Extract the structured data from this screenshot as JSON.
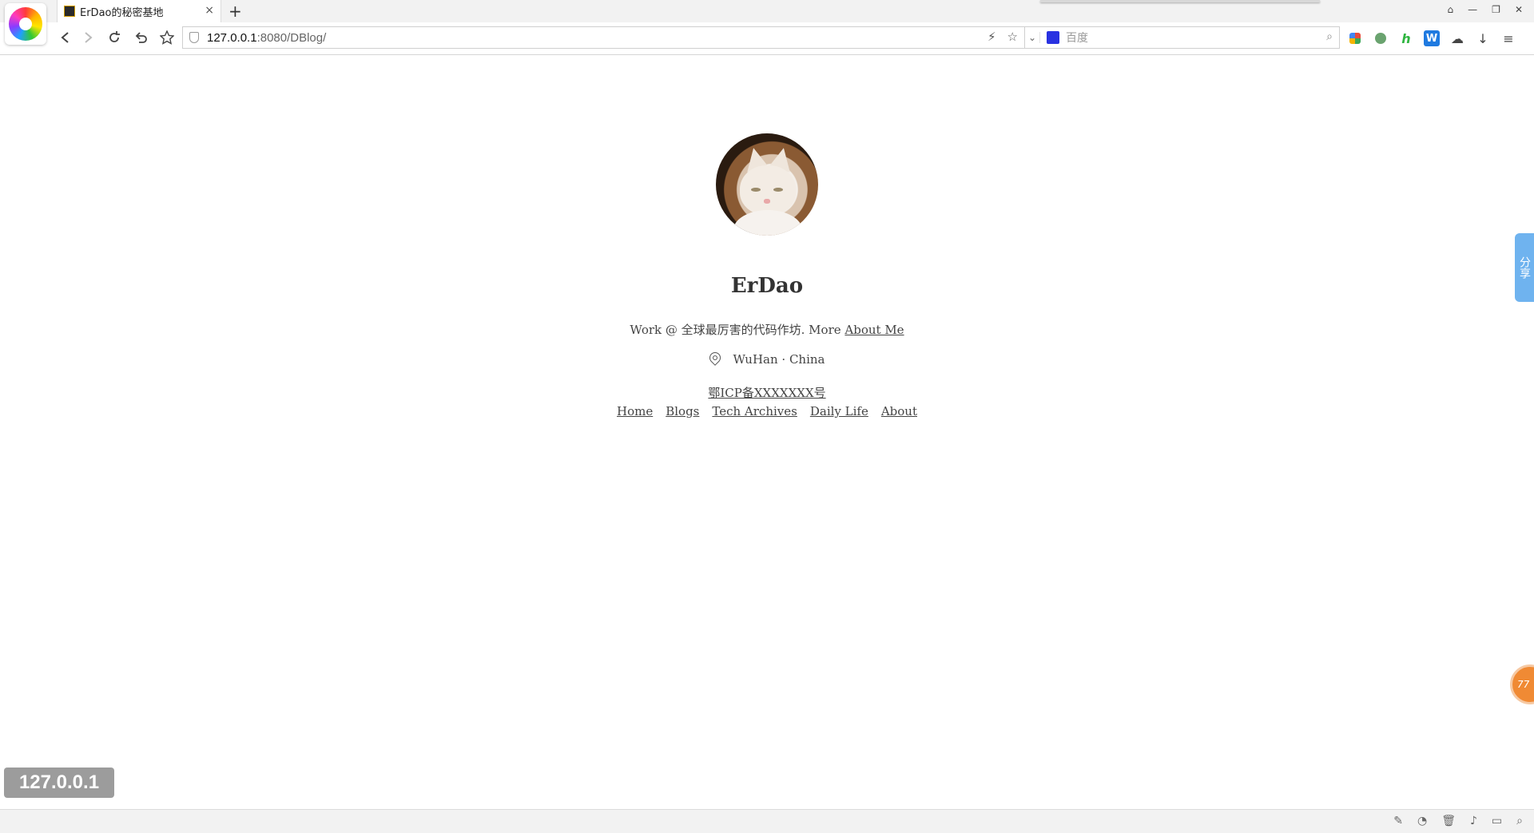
{
  "browser": {
    "tab_title": "ErDao的秘密基地",
    "tab_close": "×",
    "new_tab": "+",
    "url_host": "127.0.0.1",
    "url_path": ":8080/DBlog/",
    "search_placeholder": "百度",
    "window_controls": [
      "⌂",
      "—",
      "❐",
      "✕"
    ]
  },
  "profile": {
    "name": "ErDao",
    "tagline_prefix": "Work @ 全球最厉害的代码作坊. More ",
    "about_link": "About Me",
    "location": "WuHan · China",
    "icp": "鄂ICP备XXXXXXX号"
  },
  "nav": {
    "links": [
      "Home",
      "Blogs",
      "Tech Archives",
      "Daily Life",
      "About"
    ]
  },
  "widgets": {
    "share_label": "分享",
    "badge_text": "77",
    "host_badge": "127.0.0.1"
  },
  "colors": {
    "share_tab": "#6fb3ef",
    "badge": "#f08a34"
  }
}
